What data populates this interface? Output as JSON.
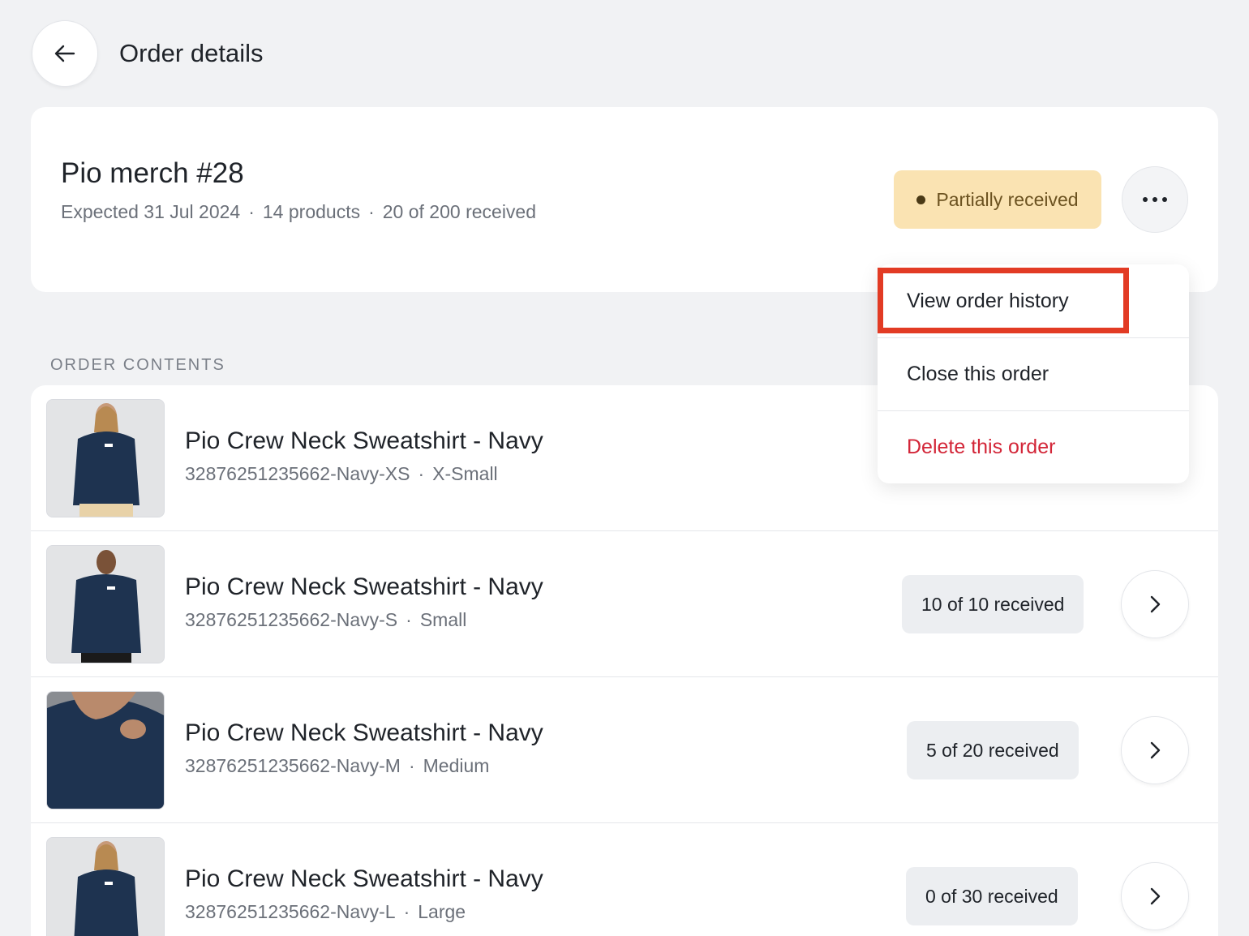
{
  "header": {
    "back_icon": "arrow-left-icon",
    "title": "Order details"
  },
  "summary": {
    "order_name": "Pio merch #28",
    "expected": "Expected 31 Jul 2024",
    "products": "14 products",
    "received": "20 of 200 received",
    "separator": "·",
    "status": "Partially received",
    "status_color": "#fae3b2",
    "more_icon": "more-horizontal-icon"
  },
  "section_label": "ORDER CONTENTS",
  "items": [
    {
      "name": "Pio Crew Neck Sweatshirt - Navy",
      "sku": "32876251235662-Navy-XS",
      "size": "X-Small",
      "received": ""
    },
    {
      "name": "Pio Crew Neck Sweatshirt - Navy",
      "sku": "32876251235662-Navy-S",
      "size": "Small",
      "received": "10 of 10 received"
    },
    {
      "name": "Pio Crew Neck Sweatshirt - Navy",
      "sku": "32876251235662-Navy-M",
      "size": "Medium",
      "received": "5 of 20 received"
    },
    {
      "name": "Pio Crew Neck Sweatshirt - Navy",
      "sku": "32876251235662-Navy-L",
      "size": "Large",
      "received": "0 of 30 received"
    }
  ],
  "menu": {
    "items": [
      {
        "label": "View order history"
      },
      {
        "label": "Close this order"
      },
      {
        "label": "Delete this order",
        "color": "#d32638"
      }
    ],
    "highlight_color": "#e23b24"
  },
  "colors": {
    "background": "#f1f2f4",
    "product_navy": "#1e3350"
  }
}
